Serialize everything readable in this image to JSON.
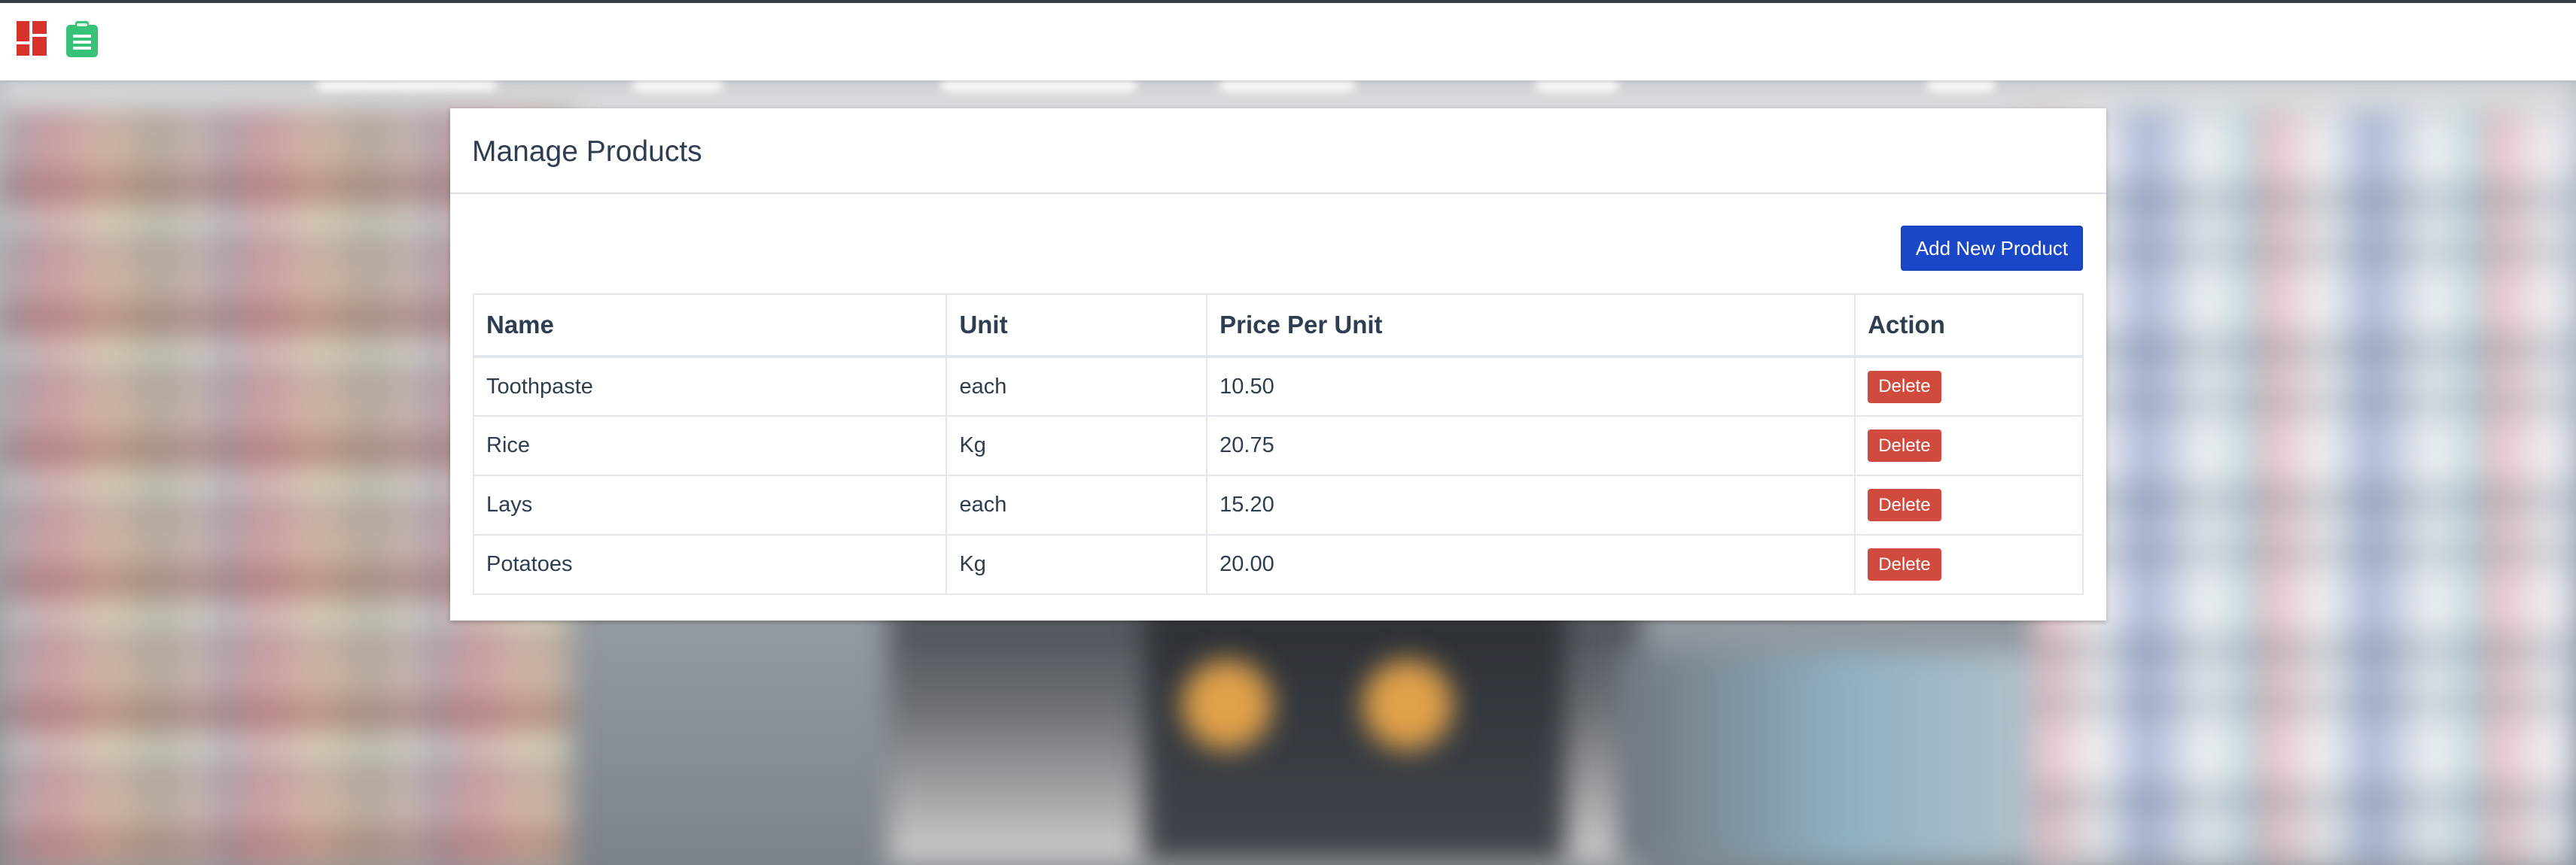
{
  "header": {
    "icons": [
      "dashboard-icon",
      "clipboard-icon"
    ],
    "icon_colors": {
      "dashboard": "#d9322a",
      "clipboard": "#37c377"
    }
  },
  "card": {
    "title": "Manage Products",
    "add_button_label": "Add New Product"
  },
  "table": {
    "columns": [
      "Name",
      "Unit",
      "Price Per Unit",
      "Action"
    ],
    "rows": [
      {
        "name": "Toothpaste",
        "unit": "each",
        "price": "10.50",
        "action": "Delete"
      },
      {
        "name": "Rice",
        "unit": "Kg",
        "price": "20.75",
        "action": "Delete"
      },
      {
        "name": "Lays",
        "unit": "each",
        "price": "15.20",
        "action": "Delete"
      },
      {
        "name": "Potatoes",
        "unit": "Kg",
        "price": "20.00",
        "action": "Delete"
      }
    ]
  },
  "colors": {
    "primary_button": "#1a47c7",
    "danger_button": "#d04a3e",
    "text": "#2e3e50"
  }
}
